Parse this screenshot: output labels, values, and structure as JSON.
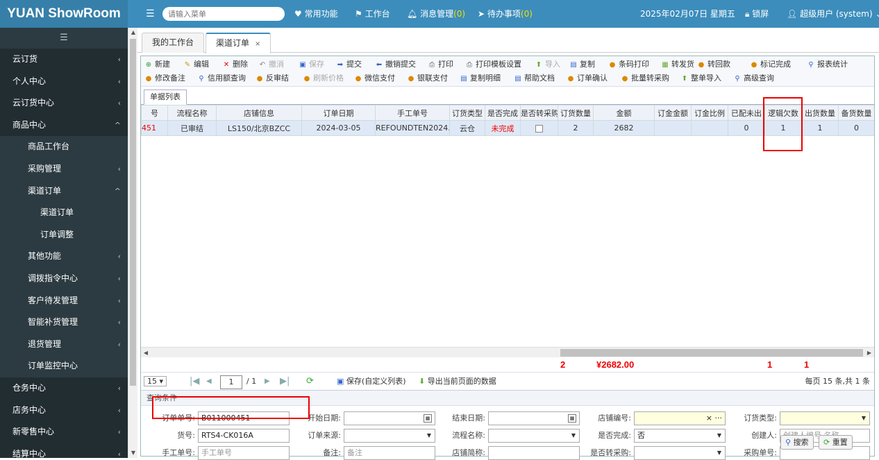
{
  "brand": "YUAN ShowRoom",
  "topbar": {
    "menu_icon": "☰",
    "search_placeholder": "请输入菜单",
    "common": "常用功能",
    "workbench": "工作台",
    "messages": "消息管理",
    "messages_count": "(0)",
    "todo": "待办事项",
    "todo_count": "(0)",
    "date": "2025年02月07日 星期五",
    "lock": "锁屏",
    "user": "超级用户 (system)"
  },
  "sidebar": {
    "toggle_icon": "☰",
    "items": [
      {
        "label": "云订货",
        "level": 0,
        "arrow": "‹"
      },
      {
        "label": "个人中心",
        "level": 0,
        "arrow": "‹"
      },
      {
        "label": "云订货中心",
        "level": 0,
        "arrow": "‹"
      },
      {
        "label": "商品中心",
        "level": 0,
        "arrow": "^"
      },
      {
        "label": "商品工作台",
        "level": 1,
        "arrow": ""
      },
      {
        "label": "采购管理",
        "level": 1,
        "arrow": "‹"
      },
      {
        "label": "渠道订单",
        "level": 1,
        "arrow": "^"
      },
      {
        "label": "渠道订单",
        "level": 2,
        "arrow": ""
      },
      {
        "label": "订单调整",
        "level": 2,
        "arrow": ""
      },
      {
        "label": "其他功能",
        "level": 1,
        "arrow": "‹"
      },
      {
        "label": "调拨指令中心",
        "level": 1,
        "arrow": "‹"
      },
      {
        "label": "客户待发管理",
        "level": 1,
        "arrow": "‹"
      },
      {
        "label": "智能补货管理",
        "level": 1,
        "arrow": "‹"
      },
      {
        "label": "退货管理",
        "level": 1,
        "arrow": "‹"
      },
      {
        "label": "订单监控中心",
        "level": 1,
        "arrow": ""
      },
      {
        "label": "仓务中心",
        "level": 0,
        "arrow": "‹"
      },
      {
        "label": "店务中心",
        "level": 0,
        "arrow": "‹"
      },
      {
        "label": "新零售中心",
        "level": 0,
        "arrow": "‹"
      },
      {
        "label": "结算中心",
        "level": 0,
        "arrow": "‹"
      }
    ]
  },
  "tabs": [
    {
      "label": "我的工作台"
    },
    {
      "label": "渠道订单",
      "close": "×"
    }
  ],
  "toolbar": {
    "row1": [
      {
        "label": "新建",
        "icon": "⊕",
        "color": "#2a9d2a"
      },
      {
        "label": "编辑",
        "icon": "✎",
        "color": "#c8a000"
      },
      {
        "label": "删除",
        "icon": "✕",
        "color": "#e00"
      },
      {
        "label": "撤消",
        "icon": "↶",
        "color": "#888",
        "disabled": true
      },
      {
        "label": "保存",
        "icon": "▣",
        "color": "#36c",
        "disabled": true
      },
      {
        "label": "提交",
        "icon": "➡",
        "color": "#36c"
      },
      {
        "label": "撤销提交",
        "icon": "⬅",
        "color": "#36c"
      },
      {
        "label": "打印",
        "icon": "⎙",
        "color": "#555"
      },
      {
        "label": "打印模板设置",
        "icon": "⎙",
        "color": "#555"
      },
      {
        "label": "导入",
        "icon": "⬆",
        "color": "#6a3",
        "disabled": true
      },
      {
        "label": "复制",
        "icon": "▤",
        "color": "#36c"
      },
      {
        "label": "条码打印",
        "icon": "●",
        "color": "#d80"
      },
      {
        "label": "转发货",
        "icon": "▦",
        "color": "#6a3"
      },
      {
        "label": "转回款",
        "icon": "●",
        "color": "#d80"
      },
      {
        "label": "标记完成",
        "icon": "●",
        "color": "#d80"
      },
      {
        "label": "报表统计",
        "icon": "⚲",
        "color": "#36c"
      }
    ],
    "row2": [
      {
        "label": "修改备注",
        "icon": "●",
        "color": "#d80"
      },
      {
        "label": "信用额查询",
        "icon": "⚲",
        "color": "#36c"
      },
      {
        "label": "反审结",
        "icon": "●",
        "color": "#d80"
      },
      {
        "label": "刷新价格",
        "icon": "●",
        "color": "#d80",
        "disabled": true
      },
      {
        "label": "微信支付",
        "icon": "●",
        "color": "#d80"
      },
      {
        "label": "银联支付",
        "icon": "●",
        "color": "#d80"
      },
      {
        "label": "复制明细",
        "icon": "▤",
        "color": "#36c"
      },
      {
        "label": "帮助文档",
        "icon": "▤",
        "color": "#36c"
      },
      {
        "label": "订单确认",
        "icon": "●",
        "color": "#d80"
      },
      {
        "label": "批量转采购",
        "icon": "●",
        "color": "#d80"
      },
      {
        "label": "整单导入",
        "icon": "⬆",
        "color": "#6a3"
      },
      {
        "label": "高级查询",
        "icon": "⚲",
        "color": "#36c"
      }
    ]
  },
  "subtab": "单据列表",
  "grid": {
    "columns": [
      "号",
      "流程名称",
      "店铺信息",
      "订单日期",
      "手工单号",
      "订货类型",
      "是否完成",
      "是否转采购",
      "订货数量",
      "金额",
      "订金金额",
      "订金比例",
      "已配未出",
      "逻辑欠数",
      "出货数量",
      "备货数量"
    ],
    "rows": [
      [
        "451",
        "已审结",
        "LS150/北京BZCC",
        "2024-03-05",
        "REFOUNDTEN2024...",
        "云仓",
        "未完成",
        "",
        "2",
        "2682",
        "",
        "",
        "0",
        "1",
        "1",
        "0"
      ]
    ]
  },
  "totals": {
    "qty": "2",
    "amount": "¥2682.00",
    "logic_owe": "1",
    "ship_qty": "1"
  },
  "pager": {
    "page_size": "15",
    "current_page": "1",
    "total_pages": "/ 1",
    "save_label": "保存(自定义列表)",
    "export_label": "导出当前页面的数据",
    "summary": "每页 15 条,共 1 条"
  },
  "query": {
    "title": "查询条件",
    "order_no_label": "订单单号:",
    "order_no": "B011000451",
    "start_date_label": "开始日期:",
    "end_date_label": "结束日期:",
    "store_no_label": "店铺编号:",
    "store_no_actions": "× ···",
    "order_type_label": "订货类型:",
    "sku_label": "货号:",
    "sku": "RTS4-CK016A",
    "source_label": "订单来源:",
    "flow_label": "流程名称:",
    "done_label": "是否完成:",
    "done": "否",
    "creator_label": "创建人:",
    "creator_placeholder": "创建人编号,名称",
    "manual_label": "手工单号:",
    "manual_placeholder": "手工单号",
    "remark_label": "备注:",
    "remark_placeholder": "备注",
    "store_short_label": "店铺简称:",
    "to_purchase_label": "是否转采购:",
    "purchase_no_label": "采购单号:",
    "search_btn": "搜索",
    "reset_btn": "重置"
  }
}
